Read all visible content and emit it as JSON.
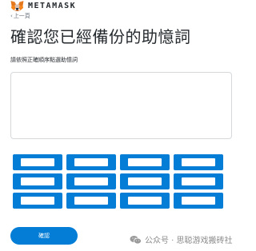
{
  "header": {
    "brand": "METAMASK",
    "logo_icon": "metamask-fox-icon"
  },
  "nav": {
    "back_label": "上一頁",
    "back_icon": "chevron-left-icon"
  },
  "page": {
    "title": "確認您已經備份的助憶詞",
    "instruction": "請依照正確順序點選助憶詞"
  },
  "word_area": {
    "selected_words": []
  },
  "word_buttons": {
    "count": 12,
    "labels": [
      "",
      "",
      "",
      "",
      "",
      "",
      "",
      "",
      "",
      "",
      "",
      ""
    ]
  },
  "confirm_button": {
    "label": "確認"
  },
  "watermark": {
    "icon": "wechat-icon",
    "text": "公众号 · 思聪游戏搬砖社"
  },
  "colors": {
    "accent": "#037dd6",
    "text": "#24292e",
    "muted": "#6a737d",
    "border": "#d6d9dc",
    "fox_orange": "#e2761b"
  }
}
